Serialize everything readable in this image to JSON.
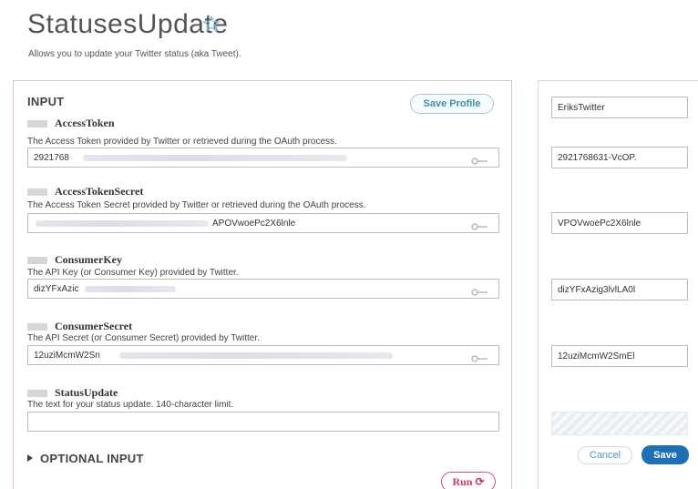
{
  "page": {
    "title": "StatusesUpdate",
    "description": "Allows you to update your Twitter status (aka Tweet)."
  },
  "input_panel": {
    "heading": "INPUT",
    "save_profile_label": "Save Profile",
    "fields": [
      {
        "name": "AccessToken",
        "description": "The Access Token provided by Twitter or retrieved during the OAuth process.",
        "value": "2921768"
      },
      {
        "name": "AccessTokenSecret",
        "description": "The Access Token Secret provided by Twitter or retrieved during the OAuth process.",
        "value": "APOVwoePc2X6lnle"
      },
      {
        "name": "ConsumerKey",
        "description": "The API Key (or Consumer Key) provided by Twitter.",
        "value": "dizYFxAzic"
      },
      {
        "name": "ConsumerSecret",
        "description": "The API Secret (or Consumer Secret) provided by Twitter.",
        "value": "12uziMcmW2Sn"
      },
      {
        "name": "StatusUpdate",
        "description": "The text for your status update. 140-character limit.",
        "value": ""
      }
    ],
    "optional_label": "OPTIONAL INPUT",
    "run_label": "Run"
  },
  "profile_panel": {
    "profile_name": "EriksTwitter",
    "values": [
      "2921768631-VcOP.",
      "VPOVwoePc2X6lnle",
      "dizYFxAzig3lvlLA0l",
      "12uziMcmW2SmEl"
    ],
    "cancel_label": "Cancel",
    "save_label": "Save"
  },
  "colors": {
    "accent": "#1e6fb3",
    "run": "#c43d69"
  }
}
